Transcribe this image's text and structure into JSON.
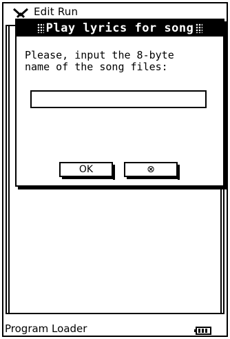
{
  "menubar": {
    "items": "Edit Run"
  },
  "dialog": {
    "title": "Play lyrics for song",
    "prompt": "Please, input the 8-byte\nname of the song files:",
    "input": {
      "value": "",
      "placeholder": ""
    },
    "ok_label": "OK",
    "cancel_label": "⊗"
  },
  "statusbar": {
    "text": "Program Loader",
    "icon": "battery-icon"
  },
  "colors": {
    "foreground": "#000000",
    "background": "#ffffff"
  }
}
